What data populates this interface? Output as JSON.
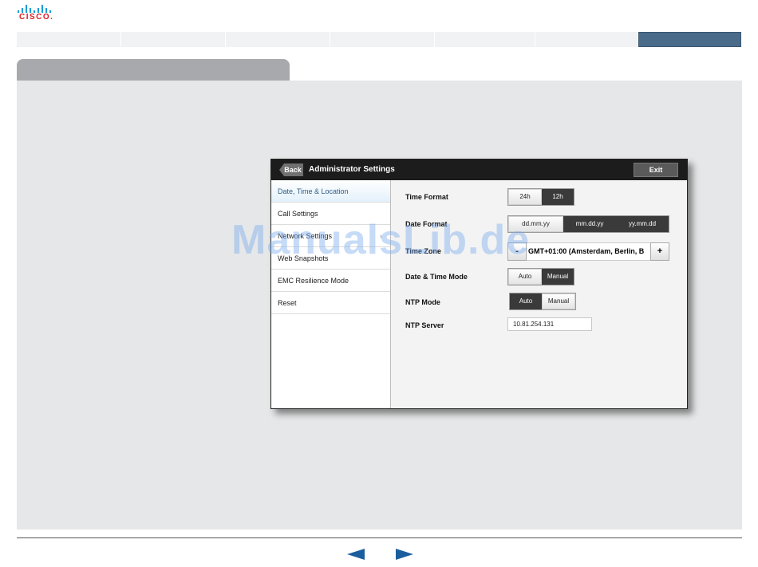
{
  "brand": {
    "logo_text": "CISCO."
  },
  "window": {
    "back_label": "Back",
    "title": "Administrator Settings",
    "exit_label": "Exit"
  },
  "sidebar": {
    "items": [
      {
        "label": "Date, Time & Location",
        "active": true
      },
      {
        "label": "Call Settings"
      },
      {
        "label": "Network Settings"
      },
      {
        "label": "Web Snapshots"
      },
      {
        "label": "EMC Resilience Mode"
      },
      {
        "label": "Reset"
      }
    ],
    "chevron_icon": "chevron-right-icon"
  },
  "settings": {
    "time_format": {
      "label": "Time Format",
      "options": [
        "24h",
        "12h"
      ],
      "selected": "24h"
    },
    "date_format": {
      "label": "Date Format",
      "options": [
        "dd.mm.yy",
        "mm.dd.yy",
        "yy.mm.dd"
      ],
      "selected": "dd.mm.yy"
    },
    "time_zone": {
      "label": "Time Zone",
      "minus": "-",
      "value": "GMT+01:00 (Amsterdam, Berlin, B",
      "plus": "+"
    },
    "date_time_mode": {
      "label": "Date & Time Mode",
      "options": [
        "Auto",
        "Manual"
      ],
      "selected": "Auto"
    },
    "ntp_mode": {
      "label": "NTP Mode",
      "options": [
        "Auto",
        "Manual"
      ],
      "selected": "Manual"
    },
    "ntp_server": {
      "label": "NTP Server",
      "value": "10.81.254.131"
    }
  },
  "watermark": "ManualsLib.de",
  "nav": {
    "prev_icon": "arrow-left-icon",
    "next_icon": "arrow-right-icon"
  },
  "colors": {
    "accent_blue": "#1b5e9e",
    "cisco_blue": "#049fd9",
    "cisco_red": "#e01a22",
    "topbtn": "#4a6b8a"
  }
}
